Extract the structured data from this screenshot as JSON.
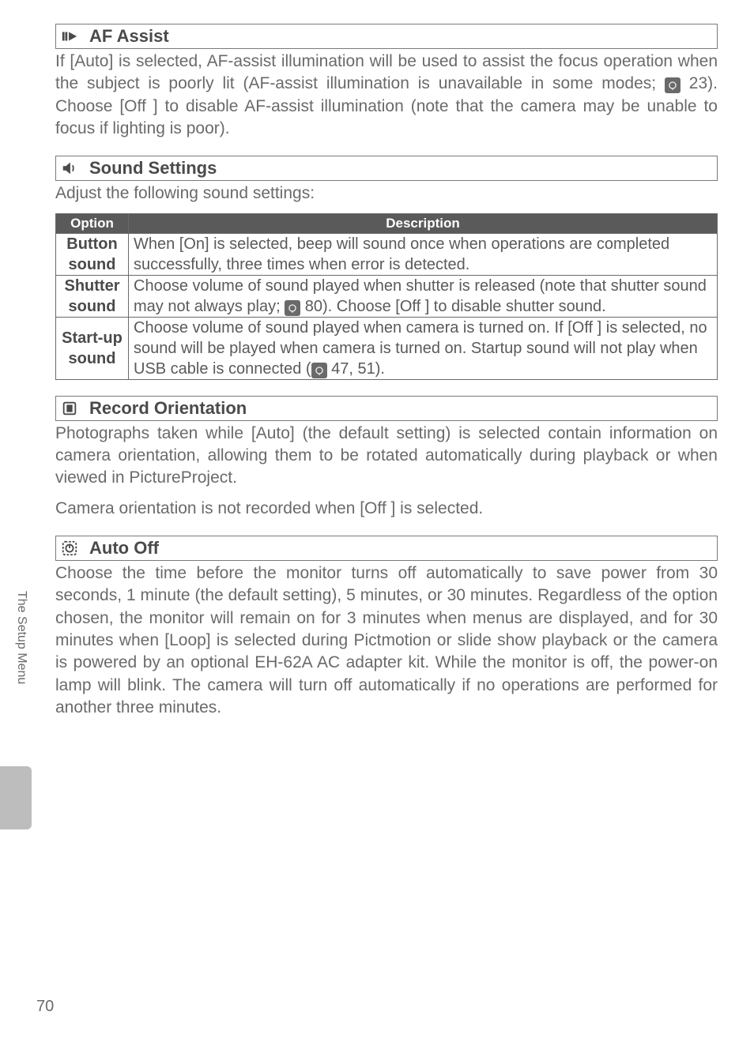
{
  "sections": {
    "af_assist": {
      "title": "AF Assist",
      "body": "If [Auto] is selected, AF-assist illumination will be used to assist the focus operation when the subject is poorly lit (AF-assist illumination is unavailable in some modes; ▮ 23).  Choose [Off ] to disable AF-assist illumination (note that the camera may be unable to focus if lighting is poor)."
    },
    "sound_settings": {
      "title": "Sound Settings",
      "intro": "Adjust the following sound settings:",
      "table": {
        "head_option": "Option",
        "head_description": "Description",
        "rows": [
          {
            "option": "Button sound",
            "desc": "When [On] is selected, beep will sound once when operations are completed successfully, three times when error is detected."
          },
          {
            "option": "Shutter sound",
            "desc": "Choose volume of sound played when shutter is released (note that shutter sound may not always play; ▮ 80).  Choose [Off ] to disable shutter sound."
          },
          {
            "option": "Start-up sound",
            "desc": "Choose volume of sound played when camera is turned on.  If [Off ] is selected, no sound will be played when camera is turned on.  Startup sound will not play when USB cable is connected (▮ 47, 51)."
          }
        ]
      }
    },
    "record_orientation": {
      "title": "Record Orientation",
      "body1": "Photographs taken while [Auto] (the default setting) is selected contain information on camera orientation, allowing them to be rotated automatically during playback or when viewed in PictureProject.",
      "body2": "Camera orientation is not recorded when [Off ] is selected."
    },
    "auto_off": {
      "title": "Auto Off",
      "body": "Choose the time before the monitor turns off automatically to save power from 30 seconds, 1 minute (the default setting), 5 minutes, or 30 minutes.  Regardless of the option chosen, the monitor will remain on for 3 minutes when menus are displayed, and for 30 minutes when [Loop] is selected during Pictmotion or slide show playback or the camera is powered by an optional EH-62A AC adapter kit.  While the monitor is off, the power-on lamp will blink.  The camera will turn off automatically if no operations are performed for another three minutes."
    }
  },
  "side_label": "The Setup Menu",
  "page_number": "70"
}
